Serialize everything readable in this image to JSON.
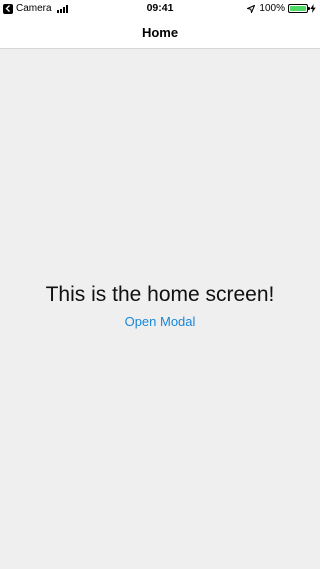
{
  "status_bar": {
    "carrier": "Camera",
    "time": "09:41",
    "battery_percent": "100%",
    "battery_level": 1.0,
    "icons": [
      "back-to-app-icon",
      "signal-icon",
      "location-arrow-icon",
      "battery-icon",
      "charging-bolt-icon"
    ]
  },
  "nav": {
    "title": "Home"
  },
  "main": {
    "headline": "This is the home screen!",
    "open_modal_label": "Open Modal"
  },
  "colors": {
    "background": "#efefef",
    "bar_background": "#ffffff",
    "link": "#1a87d8",
    "battery_fill": "#4cd964"
  }
}
